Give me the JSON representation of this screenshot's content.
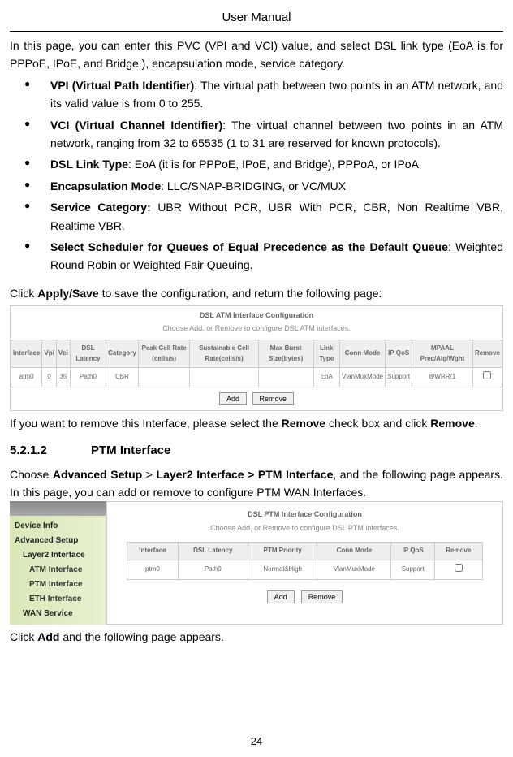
{
  "header": "User Manual",
  "intro": "In this page, you can enter this PVC (VPI and VCI) value, and select DSL link type (EoA is for PPPoE, IPoE, and Bridge.), encapsulation mode, service category.",
  "bullets": [
    {
      "bold": "VPI (Virtual Path Identifier)",
      "rest": ": The virtual path between two points in an ATM network, and its valid value is from 0 to 255."
    },
    {
      "bold": "VCI (Virtual Channel Identifier)",
      "rest": ": The virtual channel between two points in an ATM network, ranging from 32 to 65535 (1 to 31 are reserved for known protocols)."
    },
    {
      "bold": "DSL Link Type",
      "rest": ": EoA (it is for PPPoE, IPoE, and Bridge), PPPoA, or IPoA"
    },
    {
      "bold": "Encapsulation Mode",
      "rest": ": LLC/SNAP-BRIDGING, or VC/MUX"
    },
    {
      "bold": "Service Category:",
      "rest": " UBR Without PCR, UBR With PCR, CBR, Non Realtime VBR, Realtime VBR."
    },
    {
      "bold": "Select Scheduler for Queues of Equal Precedence as the Default Queue",
      "rest": ": Weighted Round Robin or Weighted Fair Queuing."
    }
  ],
  "apply_save_text_pre": "Click ",
  "apply_save_bold": "Apply/Save",
  "apply_save_text_post": " to save the configuration, and return the following page:",
  "atm": {
    "title": "DSL ATM Interface Configuration",
    "subtitle": "Choose Add, or Remove to configure DSL ATM interfaces.",
    "headers": [
      "Interface",
      "Vpi",
      "Vci",
      "DSL Latency",
      "Category",
      "Peak Cell Rate (cells/s)",
      "Sustainable Cell Rate(cells/s)",
      "Max Burst Size(bytes)",
      "Link Type",
      "Conn Mode",
      "IP QoS",
      "MPAAL Prec/Alg/Wght",
      "Remove"
    ],
    "row": [
      "atm0",
      "0",
      "35",
      "Path0",
      "UBR",
      "",
      "",
      "",
      "EoA",
      "VlanMuxMode",
      "Support",
      "8/WRR/1",
      ""
    ],
    "buttons": {
      "add": "Add",
      "remove": "Remove"
    }
  },
  "remove_text1": "If you want to remove this Interface, please select the ",
  "remove_bold": "Remove",
  "remove_text2": " check box and click ",
  "remove_bold2": "Remove",
  "remove_text3": ".",
  "section_number": "5.2.1.2",
  "section_title": "PTM Interface",
  "ptm_intro_pre": "Choose ",
  "ptm_intro_b1": "Advanced Setup",
  "ptm_intro_mid1": " > ",
  "ptm_intro_b2": "Layer2 Interface > PTM Interface",
  "ptm_intro_post": ", and the following page appears. In this page, you can add or remove to configure PTM WAN Interfaces.",
  "sidebar": {
    "items": [
      {
        "label": "Device Info",
        "cls": "bold-item"
      },
      {
        "label": "Advanced Setup",
        "cls": "bold-item"
      },
      {
        "label": "Layer2 Interface",
        "cls": "bold-item menu-sub"
      },
      {
        "label": "ATM Interface",
        "cls": "bold-item menu-subsub"
      },
      {
        "label": "PTM Interface",
        "cls": "bold-item menu-subsub"
      },
      {
        "label": "ETH Interface",
        "cls": "bold-item menu-subsub"
      },
      {
        "label": "WAN Service",
        "cls": "bold-item menu-sub"
      }
    ]
  },
  "ptm": {
    "title": "DSL PTM Interface Configuration",
    "subtitle": "Choose Add, or Remove to configure DSL PTM interfaces.",
    "headers": [
      "Interface",
      "DSL Latency",
      "PTM Priority",
      "Conn Mode",
      "IP QoS",
      "Remove"
    ],
    "row": [
      "ptm0",
      "Path0",
      "Normal&High",
      "VlanMuxMode",
      "Support",
      ""
    ],
    "buttons": {
      "add": "Add",
      "remove": "Remove"
    }
  },
  "click_add_pre": "Click ",
  "click_add_bold": "Add",
  "click_add_post": " and the following page appears.",
  "page_number": "24"
}
